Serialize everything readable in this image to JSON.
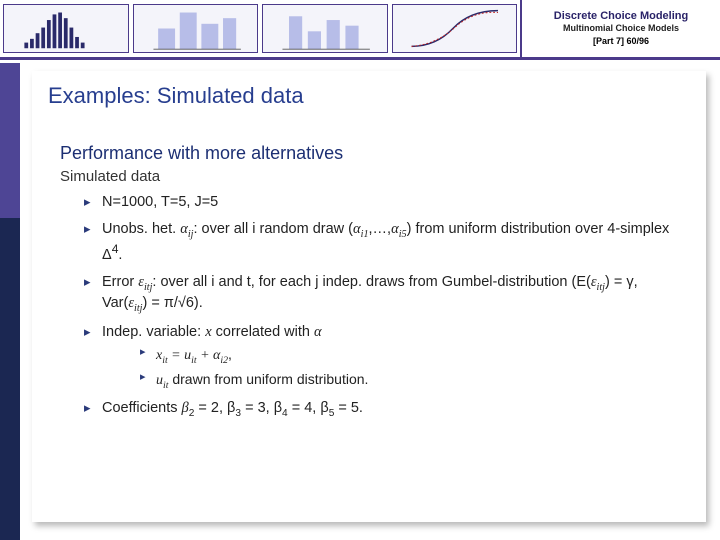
{
  "header": {
    "title": "Discrete Choice Modeling",
    "subtitle": "Multinomial Choice Models",
    "part": "[Part 7]   60/96"
  },
  "slide": {
    "title": "Examples: Simulated data",
    "section_title": "Performance with more alternatives",
    "subheading": "Simulated data",
    "bullets": {
      "b1": "N=1000, T=5, J=5",
      "b2_a": "Unobs. het. ",
      "b2_alpha": "α",
      "b2_sub": "ij",
      "b2_b": ": over all i random draw (",
      "b2_c": "α",
      "b2_csub": "i1",
      "b2_d": ",…,",
      "b2_e": "α",
      "b2_esub": "i5",
      "b2_f": ") from uniform distribution over 4-simplex Δ",
      "b2_g": "4",
      "b2_h": ".",
      "b3_a": "Error ",
      "b3_eps": "ε",
      "b3_sub": "itj",
      "b3_b": ": over all i and t, for each j indep. draws from Gumbel-distribution (E(",
      "b3_c": "ε",
      "b3_csub": "itj",
      "b3_d": ") = γ, Var(",
      "b3_e": "ε",
      "b3_esub": "itj",
      "b3_f": ") = π/√6).",
      "b4_a": "Indep. variable: ",
      "b4_x": "x",
      "b4_b": " correlated with ",
      "b4_alpha": "α",
      "b4sub1_a": "x",
      "b4sub1_asub": "it",
      "b4sub1_b": " = u",
      "b4sub1_bsub": "it",
      "b4sub1_c": " + α",
      "b4sub1_csub": "i2",
      "b4sub1_d": ",",
      "b4sub2_a": "u",
      "b4sub2_asub": "it",
      "b4sub2_b": " drawn from uniform distribution.",
      "b5_a": "Coefficients ",
      "b5_b": "β",
      "b5_b2": "2",
      "b5_c": " = 2, β",
      "b5_c2": "3",
      "b5_d": " = 3, β",
      "b5_d2": "4",
      "b5_e": " = 4, β",
      "b5_e2": "5",
      "b5_f": " = 5."
    }
  }
}
